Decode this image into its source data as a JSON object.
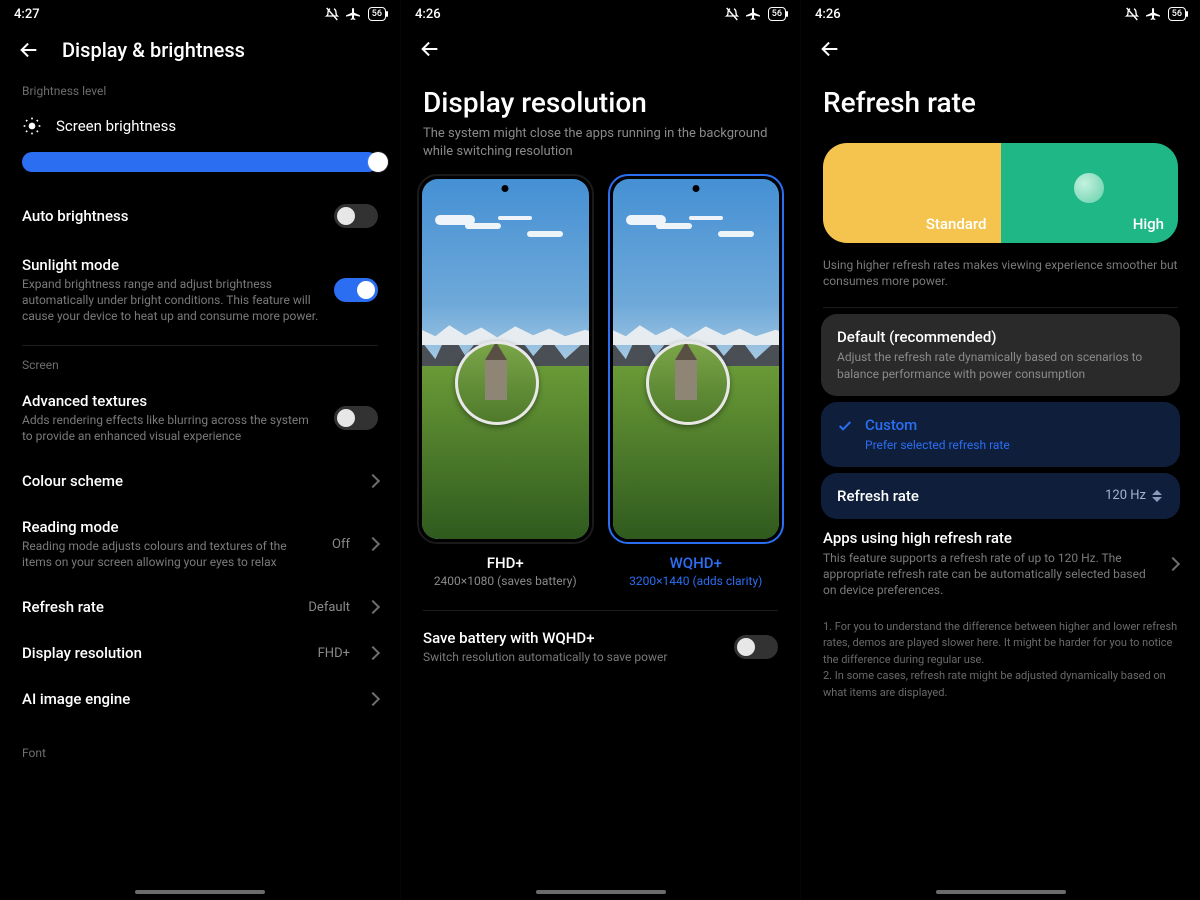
{
  "panel1": {
    "time": "4:27",
    "battery": "56",
    "title": "Display & brightness",
    "section_brightness": "Brightness level",
    "screen_brightness": "Screen brightness",
    "auto_brightness": "Auto brightness",
    "sunlight_mode": {
      "label": "Sunlight mode",
      "desc": "Expand brightness range and adjust brightness automatically under bright conditions. This feature will cause your device to heat up and consume more power."
    },
    "section_screen": "Screen",
    "advanced_textures": {
      "label": "Advanced textures",
      "desc": "Adds rendering effects like blurring across the system to provide an enhanced visual experience"
    },
    "colour_scheme": "Colour scheme",
    "reading_mode": {
      "label": "Reading mode",
      "desc": "Reading mode adjusts colours and textures of the items on your screen allowing your eyes to relax",
      "value": "Off"
    },
    "refresh_rate": {
      "label": "Refresh rate",
      "value": "Default"
    },
    "display_resolution": {
      "label": "Display resolution",
      "value": "FHD+"
    },
    "ai_image_engine": "AI image engine",
    "section_font": "Font"
  },
  "panel2": {
    "time": "4:26",
    "battery": "56",
    "title": "Display resolution",
    "subtitle": "The system might close the apps running in the background while switching resolution",
    "opt_a": {
      "name": "FHD+",
      "detail": "2400×1080 (saves battery)"
    },
    "opt_b": {
      "name": "WQHD+",
      "detail": "3200×1440 (adds clarity)"
    },
    "save_battery": {
      "label": "Save battery with WQHD+",
      "desc": "Switch resolution automatically to save power"
    }
  },
  "panel3": {
    "time": "4:26",
    "battery": "56",
    "title": "Refresh rate",
    "seg_a": "Standard",
    "seg_b": "High",
    "info": "Using higher refresh rates makes viewing experience smoother but consumes more power.",
    "default_opt": {
      "title": "Default (recommended)",
      "desc": "Adjust the refresh rate dynamically based on scenarios to balance performance with power consumption"
    },
    "custom_opt": {
      "title": "Custom",
      "desc": "Prefer selected refresh rate"
    },
    "rate_row": {
      "label": "Refresh rate",
      "value": "120 Hz"
    },
    "apps_row": {
      "label": "Apps using high refresh rate",
      "desc": "This feature supports a refresh rate of up to 120 Hz. The appropriate refresh rate can be automatically selected based on device preferences."
    },
    "note1": "1. For you to understand the difference between higher and lower refresh rates, demos are played slower here. It might be harder for you to notice the difference during regular use.",
    "note2": "2. In some cases, refresh rate might be adjusted dynamically based on what items are displayed."
  }
}
